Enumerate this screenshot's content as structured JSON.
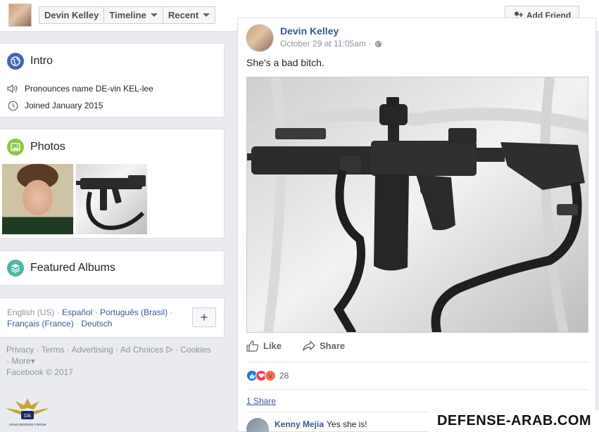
{
  "header": {
    "tabs": [
      {
        "label": "Devin Kelley"
      },
      {
        "label": "Timeline"
      },
      {
        "label": "Recent"
      }
    ],
    "add_friend_label": "Add Friend"
  },
  "intro": {
    "title": "Intro",
    "pronounce": "Pronounces name DE-vin KEL-lee",
    "joined": "Joined January 2015"
  },
  "photos": {
    "title": "Photos"
  },
  "featured": {
    "title": "Featured Albums"
  },
  "languages": {
    "current": "English (US)",
    "links": [
      "Español",
      "Português (Brasil)",
      "Français (France)",
      "Deutsch"
    ],
    "more_button": "+"
  },
  "footer": {
    "links": [
      "Privacy",
      "Terms",
      "Advertising",
      "Ad Choices",
      "Cookies",
      "More"
    ],
    "copyright": "Facebook © 2017"
  },
  "post": {
    "author": "Devin Kelley",
    "date": "October 29 at 11:05am",
    "separator": "·",
    "text": "She's a bad bitch.",
    "like_label": "Like",
    "share_label": "Share",
    "reaction_count": "28",
    "share_count": "1 Share",
    "comment": {
      "name": "Kenny Mejia",
      "text": "Yes she is!"
    }
  },
  "watermark": {
    "right": "DEFENSE-ARAB.COM",
    "left_logo": "DA",
    "left_caption": "ARAB DEFENSE FORUM"
  },
  "colors": {
    "link": "#385898",
    "like_blue": "#1877f2",
    "love_red": "#f33e58",
    "angry_orange": "#f7714c"
  }
}
